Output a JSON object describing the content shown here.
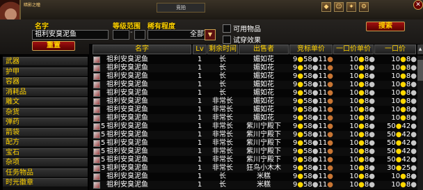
{
  "top": {
    "player_name": "暗影之瞳",
    "tab_label": "竞拍"
  },
  "filters": {
    "name_label": "名字",
    "name_value": "祖利安臭泥鱼",
    "level_label": "等级范围",
    "rarity_label": "稀有程度",
    "rarity_value": "全部",
    "usable_label": "可用物品",
    "tryon_label": "试穿效果",
    "search_button": "搜索",
    "reset_button": "重置"
  },
  "categories": [
    "武器",
    "护甲",
    "容器",
    "消耗品",
    "雕文",
    "杂货",
    "弹药",
    "箭袋",
    "配方",
    "宝石",
    "杂项",
    "任务物品",
    "时光徽章"
  ],
  "columns": {
    "name": "名字",
    "lv": "Lv",
    "time": "剩余时间",
    "seller": "出售者",
    "bid": "竞标单价",
    "buyout_unit": "一口价单价",
    "buyout": "一口价"
  },
  "rows": [
    {
      "qty": "",
      "name": "祖利安臭泥鱼",
      "lv": "1",
      "time": "长",
      "seller": "媚如花",
      "bid": {
        "g": "9",
        "s": "58",
        "c": "11"
      },
      "unit": {
        "g": "10",
        "s": "8",
        "c": ""
      },
      "buy": {
        "g": "10",
        "s": "8",
        "c": ""
      }
    },
    {
      "qty": "",
      "name": "祖利安臭泥鱼",
      "lv": "1",
      "time": "长",
      "seller": "媚如花",
      "bid": {
        "g": "9",
        "s": "58",
        "c": "11"
      },
      "unit": {
        "g": "10",
        "s": "8",
        "c": ""
      },
      "buy": {
        "g": "10",
        "s": "8",
        "c": ""
      }
    },
    {
      "qty": "",
      "name": "祖利安臭泥鱼",
      "lv": "1",
      "time": "长",
      "seller": "媚如花",
      "bid": {
        "g": "9",
        "s": "58",
        "c": "11"
      },
      "unit": {
        "g": "10",
        "s": "8",
        "c": ""
      },
      "buy": {
        "g": "10",
        "s": "8",
        "c": ""
      }
    },
    {
      "qty": "",
      "name": "祖利安臭泥鱼",
      "lv": "1",
      "time": "长",
      "seller": "媚如花",
      "bid": {
        "g": "9",
        "s": "58",
        "c": "11"
      },
      "unit": {
        "g": "10",
        "s": "8",
        "c": ""
      },
      "buy": {
        "g": "10",
        "s": "8",
        "c": ""
      }
    },
    {
      "qty": "",
      "name": "祖利安臭泥鱼",
      "lv": "1",
      "time": "长",
      "seller": "媚如花",
      "bid": {
        "g": "9",
        "s": "58",
        "c": "11"
      },
      "unit": {
        "g": "10",
        "s": "8",
        "c": ""
      },
      "buy": {
        "g": "10",
        "s": "8",
        "c": ""
      }
    },
    {
      "qty": "",
      "name": "祖利安臭泥鱼",
      "lv": "1",
      "time": "非常长",
      "seller": "媚如花",
      "bid": {
        "g": "9",
        "s": "58",
        "c": "11"
      },
      "unit": {
        "g": "10",
        "s": "8",
        "c": ""
      },
      "buy": {
        "g": "10",
        "s": "8",
        "c": ""
      }
    },
    {
      "qty": "",
      "name": "祖利安臭泥鱼",
      "lv": "1",
      "time": "非常长",
      "seller": "媚如花",
      "bid": {
        "g": "9",
        "s": "58",
        "c": "11"
      },
      "unit": {
        "g": "10",
        "s": "8",
        "c": ""
      },
      "buy": {
        "g": "10",
        "s": "8",
        "c": ""
      }
    },
    {
      "qty": "",
      "name": "祖利安臭泥鱼",
      "lv": "1",
      "time": "非常长",
      "seller": "媚如花",
      "bid": {
        "g": "9",
        "s": "58",
        "c": "11"
      },
      "unit": {
        "g": "10",
        "s": "8",
        "c": ""
      },
      "buy": {
        "g": "10",
        "s": "8",
        "c": ""
      }
    },
    {
      "qty": "5",
      "name": "祖利安臭泥鱼",
      "lv": "1",
      "time": "非常长",
      "seller": "紫川宁殿下",
      "bid": {
        "g": "9",
        "s": "58",
        "c": "11"
      },
      "unit": {
        "g": "10",
        "s": "8",
        "c": ""
      },
      "buy": {
        "g": "50",
        "s": "42",
        "c": ""
      }
    },
    {
      "qty": "5",
      "name": "祖利安臭泥鱼",
      "lv": "1",
      "time": "非常长",
      "seller": "紫川宁殿下",
      "bid": {
        "g": "9",
        "s": "58",
        "c": "11"
      },
      "unit": {
        "g": "10",
        "s": "8",
        "c": ""
      },
      "buy": {
        "g": "50",
        "s": "42",
        "c": ""
      }
    },
    {
      "qty": "5",
      "name": "祖利安臭泥鱼",
      "lv": "1",
      "time": "非常长",
      "seller": "紫川宁殿下",
      "bid": {
        "g": "9",
        "s": "58",
        "c": "11"
      },
      "unit": {
        "g": "10",
        "s": "8",
        "c": ""
      },
      "buy": {
        "g": "50",
        "s": "42",
        "c": ""
      }
    },
    {
      "qty": "5",
      "name": "祖利安臭泥鱼",
      "lv": "1",
      "time": "非常长",
      "seller": "紫川宁殿下",
      "bid": {
        "g": "9",
        "s": "58",
        "c": "11"
      },
      "unit": {
        "g": "10",
        "s": "8",
        "c": ""
      },
      "buy": {
        "g": "50",
        "s": "42",
        "c": ""
      }
    },
    {
      "qty": "5",
      "name": "祖利安臭泥鱼",
      "lv": "1",
      "time": "非常长",
      "seller": "紫川宁殿下",
      "bid": {
        "g": "9",
        "s": "58",
        "c": "11"
      },
      "unit": {
        "g": "10",
        "s": "8",
        "c": ""
      },
      "buy": {
        "g": "50",
        "s": "42",
        "c": ""
      }
    },
    {
      "qty": "3",
      "name": "祖利安臭泥鱼",
      "lv": "1",
      "time": "非常长",
      "seller": "狂鸟小木木",
      "bid": {
        "g": "9",
        "s": "58",
        "c": "11"
      },
      "unit": {
        "g": "10",
        "s": "8",
        "c": ""
      },
      "buy": {
        "g": "30",
        "s": "25",
        "c": ""
      }
    },
    {
      "qty": "",
      "name": "祖利安臭泥鱼",
      "lv": "1",
      "time": "长",
      "seller": "米糕",
      "bid": {
        "g": "9",
        "s": "58",
        "c": "11"
      },
      "unit": {
        "g": "10",
        "s": "8",
        "c": ""
      },
      "buy": {
        "g": "10",
        "s": "8",
        "c": ""
      }
    },
    {
      "qty": "",
      "name": "祖利安臭泥鱼",
      "lv": "1",
      "time": "长",
      "seller": "米糕",
      "bid": {
        "g": "9",
        "s": "58",
        "c": "11"
      },
      "unit": {
        "g": "10",
        "s": "8",
        "c": ""
      },
      "buy": {
        "g": "10",
        "s": "8",
        "c": ""
      }
    }
  ]
}
